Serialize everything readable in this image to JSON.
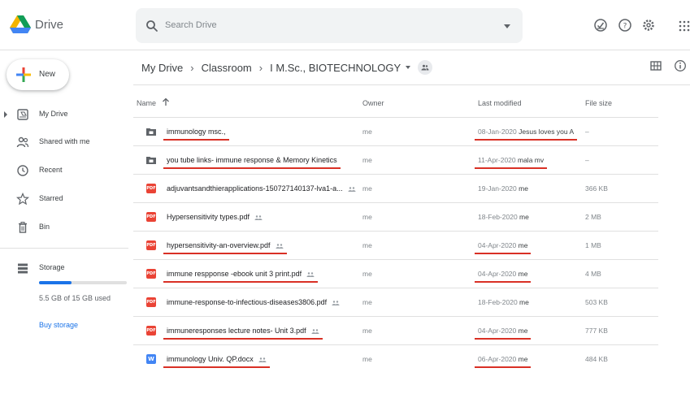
{
  "app": {
    "name": "Drive"
  },
  "search": {
    "placeholder": "Search Drive"
  },
  "sidebar": {
    "new_label": "New",
    "items": [
      {
        "label": "My Drive",
        "icon": "my-drive-icon"
      },
      {
        "label": "Shared with me",
        "icon": "shared-with-me-icon"
      },
      {
        "label": "Recent",
        "icon": "clock-icon"
      },
      {
        "label": "Starred",
        "icon": "star-icon"
      },
      {
        "label": "Bin",
        "icon": "trash-icon"
      }
    ],
    "storage": {
      "label": "Storage",
      "used_text": "5.5 GB of 15 GB used",
      "used_fraction": 0.37,
      "buy_label": "Buy storage"
    }
  },
  "breadcrumb": {
    "items": [
      "My Drive",
      "Classroom",
      "I M.Sc., BIOTECHNOLOGY"
    ]
  },
  "table": {
    "headers": {
      "name": "Name",
      "owner": "Owner",
      "modified": "Last modified",
      "size": "File size"
    },
    "rows": [
      {
        "type": "folder",
        "name": "immunology msc.,",
        "owner": "me",
        "date": "08-Jan-2020",
        "by": "Jesus loves you A",
        "size": "–",
        "shared": false
      },
      {
        "type": "folder",
        "name": "you tube links- immune response & Memory Kinetics",
        "owner": "me",
        "date": "11-Apr-2020",
        "by": "mala mv",
        "size": "–",
        "shared": false
      },
      {
        "type": "pdf",
        "name": "adjuvantsandthierapplications-150727140137-lva1-a...",
        "owner": "me",
        "date": "19-Jan-2020",
        "by": "me",
        "size": "366 KB",
        "shared": true
      },
      {
        "type": "pdf",
        "name": "Hypersensitivity types.pdf",
        "owner": "me",
        "date": "18-Feb-2020",
        "by": "me",
        "size": "2 MB",
        "shared": true
      },
      {
        "type": "pdf",
        "name": "hypersensitivity-an-overview.pdf",
        "owner": "me",
        "date": "04-Apr-2020",
        "by": "me",
        "size": "1 MB",
        "shared": true
      },
      {
        "type": "pdf",
        "name": "immune respponse -ebook unit 3 print.pdf",
        "owner": "me",
        "date": "04-Apr-2020",
        "by": "me",
        "size": "4 MB",
        "shared": true
      },
      {
        "type": "pdf",
        "name": "immune-response-to-infectious-diseases3806.pdf",
        "owner": "me",
        "date": "18-Feb-2020",
        "by": "me",
        "size": "503 KB",
        "shared": true
      },
      {
        "type": "pdf",
        "name": "immuneresponses lecture notes- Unit 3.pdf",
        "owner": "me",
        "date": "04-Apr-2020",
        "by": "me",
        "size": "777 KB",
        "shared": true
      },
      {
        "type": "doc",
        "name": "immunology Univ. QP.docx",
        "owner": "me",
        "date": "06-Apr-2020",
        "by": "me",
        "size": "484 KB",
        "shared": true
      }
    ]
  },
  "file_type_badges": {
    "pdf": "PDF",
    "doc": "W"
  },
  "colors": {
    "accent": "#1a73e8",
    "annotation": "#d93025",
    "pdf": "#ea4335",
    "doc": "#4285f4",
    "folder": "#5f6368"
  }
}
